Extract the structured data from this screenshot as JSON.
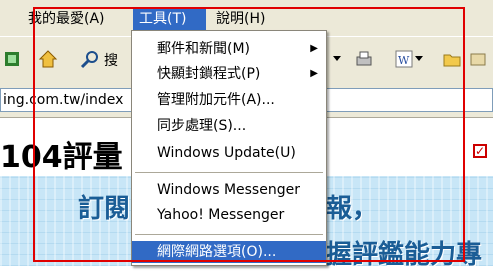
{
  "menubar": {
    "items": [
      "我的最愛(A)",
      "工具(T)",
      "說明(H)"
    ]
  },
  "toolbar": {
    "search_label": "搜",
    "icons": [
      "ie-page-icon",
      "home-icon",
      "search-icon",
      "print-icon",
      "word-icon",
      "folder-icon"
    ]
  },
  "address": {
    "value": "ing.com.tw/index"
  },
  "page": {
    "logo_text": "104評量",
    "logo_tail": "",
    "banner_left": "訂閱",
    "banner_right_top": "報，",
    "banner_right_bottom": "握評鑑能力專"
  },
  "dropdown": {
    "items": [
      {
        "label": "郵件和新聞(M)",
        "submenu": true
      },
      {
        "label": "快顯封鎖程式(P)",
        "submenu": true
      },
      {
        "label": "管理附加元件(A)...",
        "submenu": false
      },
      {
        "label": "同步處理(S)...",
        "submenu": false
      },
      {
        "label": "Windows Update(U)",
        "submenu": false
      },
      {
        "label": "Windows Messenger",
        "submenu": false
      },
      {
        "label": "Yahoo! Messenger",
        "submenu": false
      },
      {
        "label": "網際網路選項(O)...",
        "submenu": false
      }
    ],
    "selected_color": "#316ac5"
  },
  "highlight_color": "#e00000"
}
